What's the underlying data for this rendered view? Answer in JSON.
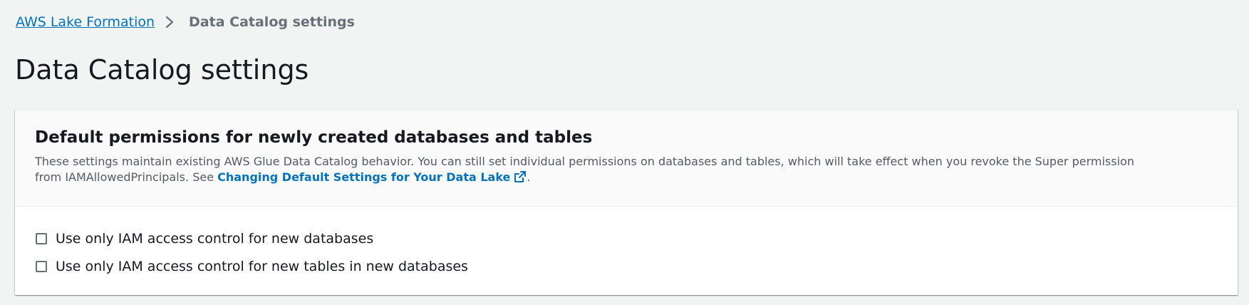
{
  "breadcrumb": {
    "parent_label": "AWS Lake Formation",
    "separator_icon": "chevron-right-icon",
    "current_label": "Data Catalog settings"
  },
  "page": {
    "title": "Data Catalog settings"
  },
  "panel": {
    "title": "Default permissions for newly created databases and tables",
    "description_prefix": "These settings maintain existing AWS Glue Data Catalog behavior. You can still set individual permissions on databases and tables, which will take effect when you revoke the Super permission from IAMAllowedPrincipals. See ",
    "description_link": "Changing Default Settings for Your Data Lake",
    "description_link_icon": "external-link-icon",
    "description_suffix": ".",
    "checkboxes": [
      {
        "label": "Use only IAM access control for new databases",
        "checked": false
      },
      {
        "label": "Use only IAM access control for new tables in new databases",
        "checked": false
      }
    ]
  },
  "colors": {
    "link": "#0073bb",
    "background": "#f2f3f3",
    "panel_header": "#fafafa",
    "text": "#16191f",
    "muted_text": "#545b64"
  }
}
